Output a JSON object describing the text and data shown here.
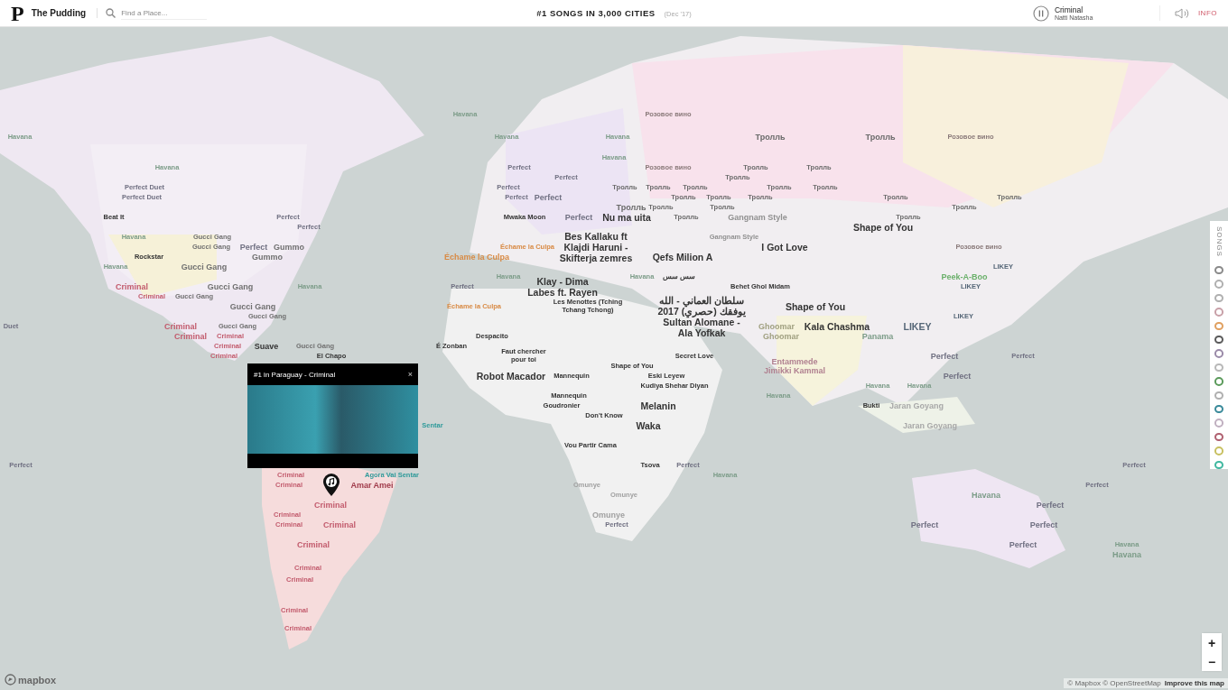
{
  "header": {
    "logo": "P",
    "site_name": "The Pudding",
    "search": {
      "placeholder": "Find a Place..."
    },
    "title": "#1 SONGS IN 3,000 CITIES",
    "date": "(Dec '17)",
    "now_playing": {
      "song": "Criminal",
      "artist": "Natti Natasha"
    },
    "info": "INFO"
  },
  "labels": [
    {
      "text": "Havana",
      "kind": "minor",
      "color": "#7c9c88"
    },
    {
      "text": "Розовое вино",
      "kind": "minor",
      "color": "#8a7a7a"
    },
    {
      "text": "Havana",
      "kind": "minor",
      "color": "#7c9c88"
    },
    {
      "text": "Havana",
      "kind": "minor",
      "color": "#7c9c88"
    },
    {
      "text": "Havana",
      "kind": "minor",
      "color": "#7c9c88"
    },
    {
      "text": "Тролль",
      "kind": "mid",
      "color": "#6a6a6a"
    },
    {
      "text": "Тролль",
      "kind": "mid",
      "color": "#6a6a6a"
    },
    {
      "text": "Розовое вино",
      "kind": "minor",
      "color": "#8a7a7a"
    },
    {
      "text": "Havana",
      "kind": "minor",
      "color": "#7c9c88"
    },
    {
      "text": "Havana",
      "kind": "minor",
      "color": "#7c9c88"
    },
    {
      "text": "Perfect",
      "kind": "minor",
      "color": "#707082"
    },
    {
      "text": "Розовое вино",
      "kind": "minor",
      "color": "#8a7a7a"
    },
    {
      "text": "Тролль",
      "kind": "minor",
      "color": "#6a6a6a"
    },
    {
      "text": "Тролль",
      "kind": "minor",
      "color": "#6a6a6a"
    },
    {
      "text": "Perfect",
      "kind": "minor",
      "color": "#707082"
    },
    {
      "text": "Тролль",
      "kind": "minor",
      "color": "#6a6a6a"
    },
    {
      "text": "Perfect Duet",
      "kind": "minor",
      "color": "#707082"
    },
    {
      "text": "Perfect",
      "kind": "minor",
      "color": "#707082"
    },
    {
      "text": "Тролль",
      "kind": "minor",
      "color": "#6a6a6a"
    },
    {
      "text": "Тролль",
      "kind": "minor",
      "color": "#6a6a6a"
    },
    {
      "text": "Тролль",
      "kind": "minor",
      "color": "#6a6a6a"
    },
    {
      "text": "Тролль",
      "kind": "minor",
      "color": "#6a6a6a"
    },
    {
      "text": "Тролль",
      "kind": "minor",
      "color": "#6a6a6a"
    },
    {
      "text": "Perfect Duet",
      "kind": "minor",
      "color": "#707082"
    },
    {
      "text": "Perfect",
      "kind": "minor",
      "color": "#707082"
    },
    {
      "text": "Perfect",
      "kind": "mid",
      "color": "#707082"
    },
    {
      "text": "Тролль",
      "kind": "minor",
      "color": "#6a6a6a"
    },
    {
      "text": "Тролль",
      "kind": "minor",
      "color": "#6a6a6a"
    },
    {
      "text": "Тролль",
      "kind": "minor",
      "color": "#6a6a6a"
    },
    {
      "text": "Тролль",
      "kind": "minor",
      "color": "#6a6a6a"
    },
    {
      "text": "Тролль",
      "kind": "minor",
      "color": "#6a6a6a"
    },
    {
      "text": "Тролль",
      "kind": "mid",
      "color": "#6a6a6a"
    },
    {
      "text": "Тролль",
      "kind": "minor",
      "color": "#6a6a6a"
    },
    {
      "text": "Тролль",
      "kind": "minor",
      "color": "#6a6a6a"
    },
    {
      "text": "Тролль",
      "kind": "minor",
      "color": "#6a6a6a"
    },
    {
      "text": "Beat It",
      "kind": "minor",
      "color": "#333333"
    },
    {
      "text": "Perfect",
      "kind": "minor",
      "color": "#707082"
    },
    {
      "text": "Mwaka Moon",
      "kind": "minor",
      "color": "#333333"
    },
    {
      "text": "Perfect",
      "kind": "mid",
      "color": "#707082"
    },
    {
      "text": "Nu ma uita",
      "kind": "major",
      "color": "#333333"
    },
    {
      "text": "Тролль",
      "kind": "minor",
      "color": "#6a6a6a"
    },
    {
      "text": "Gangnam Style",
      "kind": "mid",
      "color": "#909090"
    },
    {
      "text": "Тролль",
      "kind": "minor",
      "color": "#6a6a6a"
    },
    {
      "text": "Perfect",
      "kind": "minor",
      "color": "#707082"
    },
    {
      "text": "Shape of You",
      "kind": "major",
      "color": "#333333"
    },
    {
      "text": "Havana",
      "kind": "minor",
      "color": "#7c9c88"
    },
    {
      "text": "Gucci Gang",
      "kind": "minor",
      "color": "#707070"
    },
    {
      "text": "Gangnam Style",
      "kind": "minor",
      "color": "#909090"
    },
    {
      "text": "Gucci Gang",
      "kind": "minor",
      "color": "#707070"
    },
    {
      "text": "Perfect",
      "kind": "mid",
      "color": "#707082"
    },
    {
      "text": "Gummo",
      "kind": "mid",
      "color": "#707070"
    },
    {
      "text": "Échame la Culpa",
      "kind": "minor",
      "color": "#d88a44"
    },
    {
      "text": "Bes Kallaku ft Klajdi Haruni - Skifterja zemres",
      "kind": "major",
      "color": "#333333"
    },
    {
      "text": "I Got Love",
      "kind": "major",
      "color": "#333333"
    },
    {
      "text": "Розовое вино",
      "kind": "minor",
      "color": "#8a7a7a"
    },
    {
      "text": "Rockstar",
      "kind": "minor",
      "color": "#333333"
    },
    {
      "text": "Gummo",
      "kind": "mid",
      "color": "#707070"
    },
    {
      "text": "Échame la Culpa",
      "kind": "mid",
      "color": "#d88a44"
    },
    {
      "text": "Qefs Milion A",
      "kind": "major",
      "color": "#333333"
    },
    {
      "text": "Havana",
      "kind": "minor",
      "color": "#7c9c88"
    },
    {
      "text": "Gucci Gang",
      "kind": "mid",
      "color": "#707070"
    },
    {
      "text": "LIKEY",
      "kind": "minor",
      "color": "#556677"
    },
    {
      "text": "Havana",
      "kind": "minor",
      "color": "#7c9c88"
    },
    {
      "text": "Havana",
      "kind": "minor",
      "color": "#7c9c88"
    },
    {
      "text": "سس سس",
      "kind": "minor",
      "color": "#333333"
    },
    {
      "text": "Peek-A-Boo",
      "kind": "mid",
      "color": "#6ab06a"
    },
    {
      "text": "Criminal",
      "kind": "mid",
      "color": "#c25a6c"
    },
    {
      "text": "Gucci Gang",
      "kind": "mid",
      "color": "#707070"
    },
    {
      "text": "Havana",
      "kind": "minor",
      "color": "#7c9c88"
    },
    {
      "text": "Perfect",
      "kind": "minor",
      "color": "#707082"
    },
    {
      "text": "Klay - Dima Labes ft. Rayen",
      "kind": "major",
      "color": "#333333"
    },
    {
      "text": "Behet Ghol Midam",
      "kind": "minor",
      "color": "#333333"
    },
    {
      "text": "LIKEY",
      "kind": "minor",
      "color": "#556677"
    },
    {
      "text": "Criminal",
      "kind": "minor",
      "color": "#c25a6c"
    },
    {
      "text": "Gucci Gang",
      "kind": "minor",
      "color": "#707070"
    },
    {
      "text": "Gucci Gang",
      "kind": "mid",
      "color": "#707070"
    },
    {
      "text": "Échame la Culpa",
      "kind": "minor",
      "color": "#d88a44"
    },
    {
      "text": "Les Menottes (Tching Tchang Tchong)",
      "kind": "minor",
      "color": "#333333"
    },
    {
      "text": "Shape of You",
      "kind": "major",
      "color": "#333333"
    },
    {
      "text": "Gucci Gang",
      "kind": "minor",
      "color": "#707070"
    },
    {
      "text": "سلطان العماني - الله يوفقك (حصري) 2017 Sultan Alomane - Ala Yofkak",
      "kind": "major",
      "color": "#333333"
    },
    {
      "text": "LIKEY",
      "kind": "minor",
      "color": "#556677"
    },
    {
      "text": "Duet",
      "kind": "minor",
      "color": "#707082"
    },
    {
      "text": "Criminal",
      "kind": "mid",
      "color": "#c25a6c"
    },
    {
      "text": "Gucci Gang",
      "kind": "minor",
      "color": "#707070"
    },
    {
      "text": "Ghoomar",
      "kind": "mid",
      "color": "#a0a080"
    },
    {
      "text": "Kala Chashma",
      "kind": "major",
      "color": "#333333"
    },
    {
      "text": "LIKEY",
      "kind": "major",
      "color": "#556677"
    },
    {
      "text": "Criminal",
      "kind": "mid",
      "color": "#c25a6c"
    },
    {
      "text": "Criminal",
      "kind": "minor",
      "color": "#c25a6c"
    },
    {
      "text": "Despacito",
      "kind": "minor",
      "color": "#333333"
    },
    {
      "text": "Ghoomar",
      "kind": "mid",
      "color": "#a0a080"
    },
    {
      "text": "Panama",
      "kind": "mid",
      "color": "#7c9c88"
    },
    {
      "text": "Criminal",
      "kind": "minor",
      "color": "#c25a6c"
    },
    {
      "text": "Suave",
      "kind": "mid",
      "color": "#333333"
    },
    {
      "text": "Gucci Gang",
      "kind": "minor",
      "color": "#707070"
    },
    {
      "text": "É Zonban",
      "kind": "minor",
      "color": "#333333"
    },
    {
      "text": "Criminal",
      "kind": "minor",
      "color": "#c25a6c"
    },
    {
      "text": "El Chapo",
      "kind": "minor",
      "color": "#333333"
    },
    {
      "text": "Faut chercher pour toi",
      "kind": "minor",
      "color": "#333333"
    },
    {
      "text": "Secret Love",
      "kind": "minor",
      "color": "#333333"
    },
    {
      "text": "Perfect",
      "kind": "mid",
      "color": "#707082"
    },
    {
      "text": "Perfect",
      "kind": "minor",
      "color": "#707082"
    },
    {
      "text": "Shape of You",
      "kind": "minor",
      "color": "#333333"
    },
    {
      "text": "Entammede Jimikki Kammal",
      "kind": "mid",
      "color": "#b08090"
    },
    {
      "text": "Robot Macador",
      "kind": "major",
      "color": "#333333"
    },
    {
      "text": "Mannequin",
      "kind": "minor",
      "color": "#333333"
    },
    {
      "text": "Eski Leyew",
      "kind": "minor",
      "color": "#333333"
    },
    {
      "text": "Perfect",
      "kind": "mid",
      "color": "#707082"
    },
    {
      "text": "Kudiya Shehar Diyan",
      "kind": "minor",
      "color": "#333333"
    },
    {
      "text": "Havana",
      "kind": "minor",
      "color": "#7c9c88"
    },
    {
      "text": "Havana",
      "kind": "minor",
      "color": "#7c9c88"
    },
    {
      "text": "Mannequin",
      "kind": "minor",
      "color": "#333333"
    },
    {
      "text": "Havana",
      "kind": "minor",
      "color": "#7c9c88"
    },
    {
      "text": "Goudronier",
      "kind": "minor",
      "color": "#333333"
    },
    {
      "text": "Melanin",
      "kind": "major",
      "color": "#333333"
    },
    {
      "text": "Bukti",
      "kind": "minor",
      "color": "#333333"
    },
    {
      "text": "Jaran Goyang",
      "kind": "mid",
      "color": "#a8a8a8"
    },
    {
      "text": "Don't Know",
      "kind": "minor",
      "color": "#333333"
    },
    {
      "text": "Sentar",
      "kind": "minor",
      "color": "#2f9a9a"
    },
    {
      "text": "Waka",
      "kind": "major",
      "color": "#333333"
    },
    {
      "text": "Jaran Goyang",
      "kind": "mid",
      "color": "#a8a8a8"
    },
    {
      "text": "Vou Partir Cama",
      "kind": "minor",
      "color": "#333333"
    },
    {
      "text": "Perfect",
      "kind": "minor",
      "color": "#707082"
    },
    {
      "text": "Tsova",
      "kind": "minor",
      "color": "#333333"
    },
    {
      "text": "Perfect",
      "kind": "minor",
      "color": "#707082"
    },
    {
      "text": "Perfect",
      "kind": "minor",
      "color": "#707082"
    },
    {
      "text": "Criminal",
      "kind": "minor",
      "color": "#c25a6c"
    },
    {
      "text": "Agora Vai Sentar",
      "kind": "minor",
      "color": "#2f9a9a"
    },
    {
      "text": "Havana",
      "kind": "minor",
      "color": "#7c9c88"
    },
    {
      "text": "Criminal",
      "kind": "minor",
      "color": "#c25a6c"
    },
    {
      "text": "Amar Amei",
      "kind": "mid",
      "color": "#a03a4a"
    },
    {
      "text": "Omunye",
      "kind": "minor",
      "color": "#a0a0a0"
    },
    {
      "text": "Perfect",
      "kind": "minor",
      "color": "#707082"
    },
    {
      "text": "Omunye",
      "kind": "minor",
      "color": "#a0a0a0"
    },
    {
      "text": "Havana",
      "kind": "mid",
      "color": "#7c9c88"
    },
    {
      "text": "Criminal",
      "kind": "mid",
      "color": "#c25a6c"
    },
    {
      "text": "Perfect",
      "kind": "mid",
      "color": "#707082"
    },
    {
      "text": "Criminal",
      "kind": "minor",
      "color": "#c25a6c"
    },
    {
      "text": "Omunye",
      "kind": "mid",
      "color": "#a0a0a0"
    },
    {
      "text": "Criminal",
      "kind": "minor",
      "color": "#c25a6c"
    },
    {
      "text": "Criminal",
      "kind": "mid",
      "color": "#c25a6c"
    },
    {
      "text": "Perfect",
      "kind": "minor",
      "color": "#707082"
    },
    {
      "text": "Perfect",
      "kind": "mid",
      "color": "#707082"
    },
    {
      "text": "Perfect",
      "kind": "mid",
      "color": "#707082"
    },
    {
      "text": "Criminal",
      "kind": "mid",
      "color": "#c25a6c"
    },
    {
      "text": "Perfect",
      "kind": "mid",
      "color": "#707082"
    },
    {
      "text": "Havana",
      "kind": "minor",
      "color": "#7c9c88"
    },
    {
      "text": "Havana",
      "kind": "mid",
      "color": "#7c9c88"
    },
    {
      "text": "Criminal",
      "kind": "minor",
      "color": "#c25a6c"
    },
    {
      "text": "Criminal",
      "kind": "minor",
      "color": "#c25a6c"
    },
    {
      "text": "Criminal",
      "kind": "minor",
      "color": "#c25a6c"
    },
    {
      "text": "Criminal",
      "kind": "minor",
      "color": "#c25a6c"
    }
  ],
  "popup": {
    "title": "#1 in Paraguay - Criminal",
    "close": "×"
  },
  "songs_legend": {
    "title": "SONGS",
    "items": [
      {
        "color": "#8a8a8a"
      },
      {
        "color": "#b0b0b0"
      },
      {
        "color": "#b0b0b0"
      },
      {
        "color": "#c8a0a8"
      },
      {
        "color": "#e0a060"
      },
      {
        "color": "#5a5a5a"
      },
      {
        "color": "#9a8aa8"
      },
      {
        "color": "#b8b8b8"
      },
      {
        "color": "#5a9a5a"
      },
      {
        "color": "#b0b0b0"
      },
      {
        "color": "#3a8a9a"
      },
      {
        "color": "#c0b0c0"
      },
      {
        "color": "#b06070"
      },
      {
        "color": "#c8c060"
      },
      {
        "color": "#40b8a0"
      }
    ]
  },
  "zoom": {
    "in": "+",
    "out": "−"
  },
  "attribution": {
    "text": "© Mapbox © OpenStreetMap",
    "link": "Improve this map"
  },
  "mapbox_logo": "mapbox"
}
